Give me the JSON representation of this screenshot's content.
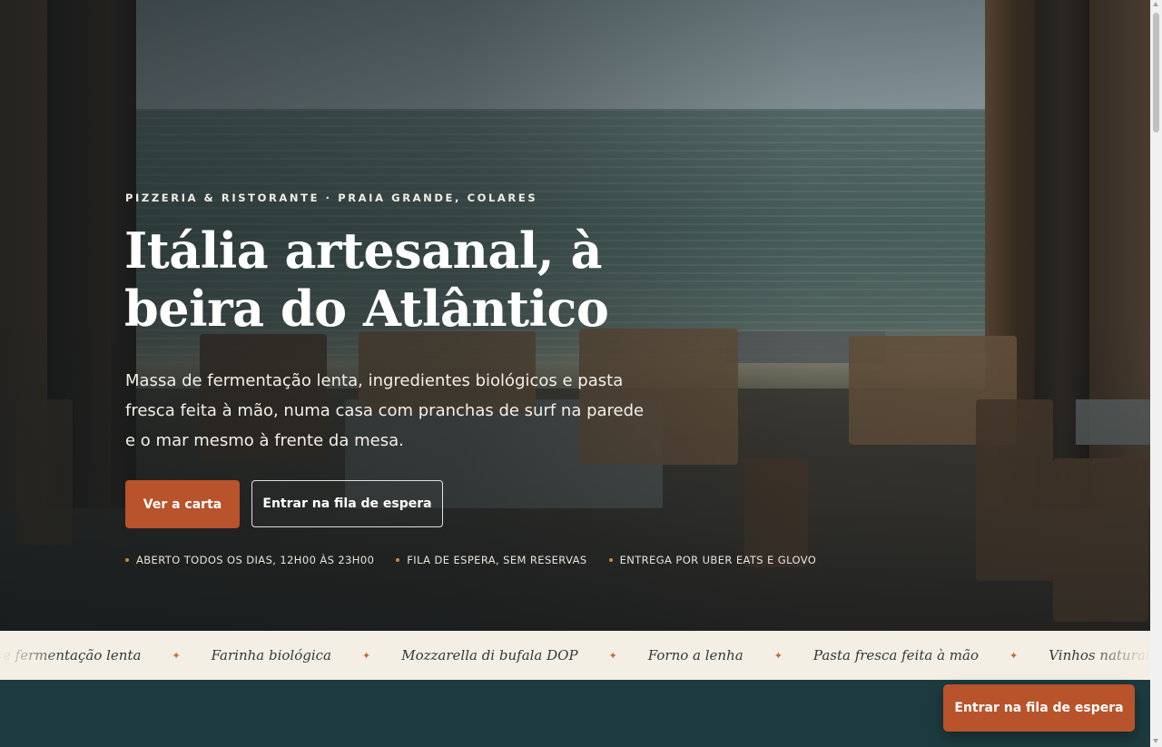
{
  "hero": {
    "eyebrow": "PIZZERIA & RISTORANTE · PRAIA GRANDE, COLARES",
    "headline_line1": "Itália artesanal, à",
    "headline_line2": "beira do Atlântico",
    "lede": "Massa de fermentação lenta, ingredientes biológicos e pasta fresca feita à mão, numa casa com pranchas de surf na parede e o mar mesmo à frente da mesa.",
    "primary_cta": "Ver a carta",
    "secondary_cta": "Entrar na fila de espera",
    "facts": [
      "ABERTO TODOS OS DIAS, 12H00 ÀS 23H00",
      "FILA DE ESPERA, SEM RESERVAS",
      "ENTREGA POR UBER EATS E GLOVO"
    ]
  },
  "marquee": {
    "items": [
      "Massa de fermentação lenta",
      "Farinha biológica",
      "Mozzarella di bufala DOP",
      "Forno a lenha",
      "Pasta fresca feita à mão",
      "Vinhos naturais portugueses"
    ],
    "separator": "✦"
  },
  "floating_cta": "Entrar na fila de espera",
  "colors": {
    "accent": "#b8532b",
    "dark_teal": "#1d3b3f",
    "cream": "#f3efe5",
    "dot": "#d08a3c"
  }
}
